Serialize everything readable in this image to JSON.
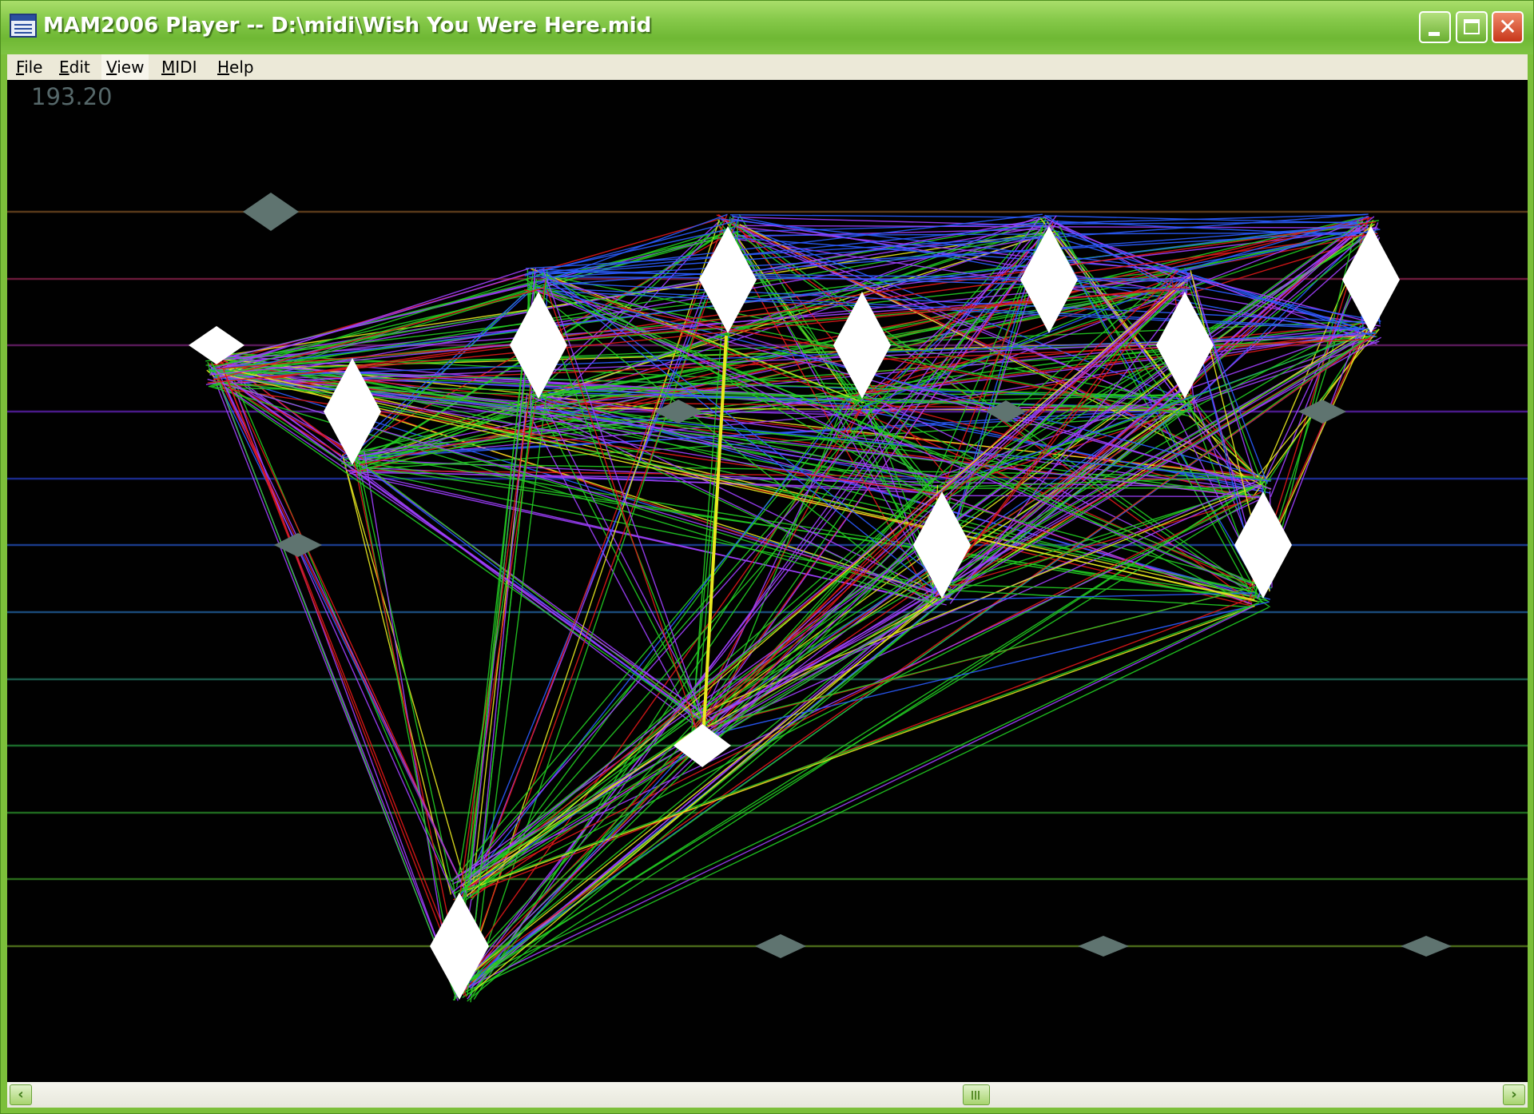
{
  "window": {
    "title": "MAM2006 Player -- D:\\midi\\Wish You Were Here.mid",
    "accent_color": "#7cbf3a",
    "close_glyph": "✕"
  },
  "menu": {
    "file": "File",
    "edit": "Edit",
    "view": "View",
    "midi": "MIDI",
    "help": "Help"
  },
  "visualization": {
    "time_readout": "193.20",
    "background_color": "#010101",
    "staff_line_colors": [
      "#5a3a1a",
      "#6a1a3a",
      "#5a1a5a",
      "#4a1a8a",
      "#1a2a8a",
      "#1a3a8a",
      "#1a4a7a",
      "#1a5a4a",
      "#1a6a2a",
      "#1f6a1f",
      "#2a6a1a",
      "#4a6a1a"
    ],
    "chord_line_colors": [
      "#2a5cff",
      "#22cc22",
      "#a040ff",
      "#e01818",
      "#e8e820"
    ],
    "note_color": "#ffffff",
    "ghost_note_color": "#5f7470"
  },
  "scrollbar": {
    "left_arrow": "‹",
    "right_arrow": "›"
  }
}
